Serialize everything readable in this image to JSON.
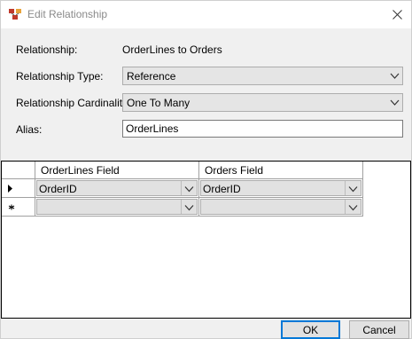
{
  "window": {
    "title": "Edit Relationship"
  },
  "form": {
    "relationship_label": "Relationship:",
    "relationship_value": "OrderLines to Orders",
    "type_label": "Relationship Type:",
    "type_value": "Reference",
    "cardinality_label": "Relationship Cardinality:",
    "cardinality_value": "One To Many",
    "alias_label": "Alias:",
    "alias_value": "OrderLines"
  },
  "grid": {
    "columns": [
      "OrderLines Field",
      "Orders Field"
    ],
    "rows": [
      {
        "marker": "current-row",
        "cells": [
          "OrderID",
          "OrderID"
        ]
      },
      {
        "marker": "new-row",
        "cells": [
          "",
          ""
        ]
      }
    ]
  },
  "buttons": {
    "ok": "OK",
    "cancel": "Cancel"
  },
  "colors": {
    "accent": "#0078d7",
    "title_text": "#8a8a8a",
    "dialog_bg": "#f0f0f0"
  }
}
